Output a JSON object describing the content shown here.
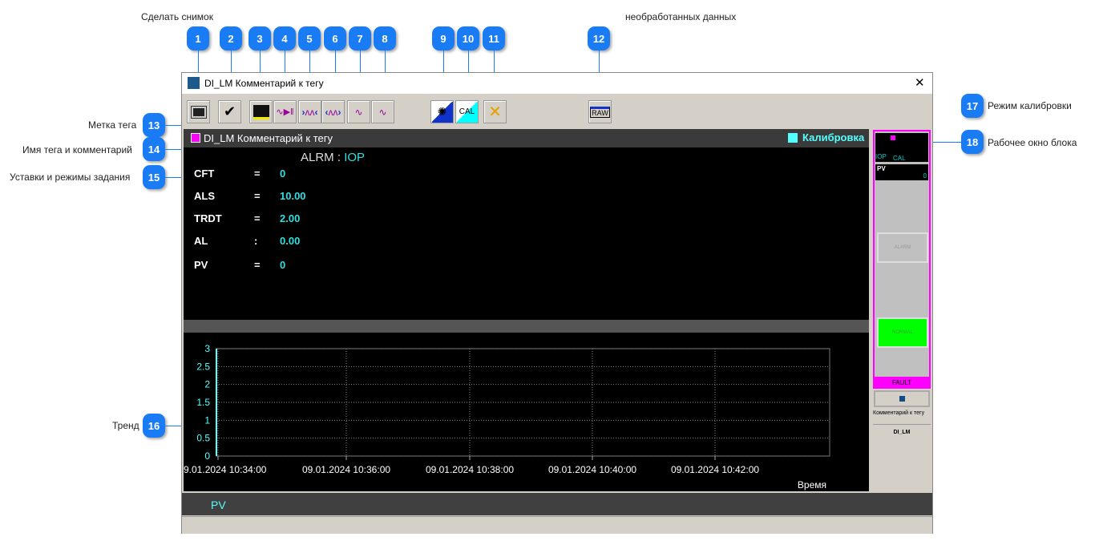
{
  "callouts": {
    "top_labels": [
      "Сделать снимок",
      "необработанных данных"
    ],
    "numbers": [
      "1",
      "2",
      "3",
      "4",
      "5",
      "6",
      "7",
      "8",
      "9",
      "10",
      "11",
      "12",
      "13",
      "14",
      "15",
      "16",
      "17",
      "18"
    ],
    "side_labels": {
      "13": "Метка тега",
      "14": "Имя тега и комментарий",
      "15": "Уставки и режимы задания",
      "16": "Тренд",
      "17": "Режим калибровки",
      "18": "Рабочее окно блока"
    }
  },
  "window": {
    "title": "DI_LM Комментарий к тегу",
    "close": "✕"
  },
  "toolbar": {
    "buttons": [
      "screenshot",
      "acknowledge",
      "trend-settings",
      "trend-pause",
      "zoom-in-x",
      "zoom-out-x",
      "zoom-in-y",
      "zoom-out-y",
      "alarm-suppress",
      "calibration",
      "maintenance",
      "raw-data"
    ],
    "cal_label": "CAL",
    "raw_label": "RAW"
  },
  "header": {
    "tag_label": "DI_LM Комментарий к тегу",
    "mode_label": "Калибровка",
    "tag_color": "#ff00ff",
    "mode_color": "#5ff"
  },
  "status": {
    "alarm_key": "ALRM",
    "sep": ":",
    "alarm_value": "IOP"
  },
  "params": [
    {
      "name": "CFT",
      "sep": "=",
      "value": "0"
    },
    {
      "name": "ALS",
      "sep": "=",
      "value": "10.00"
    },
    {
      "name": "TRDT",
      "sep": "=",
      "value": "2.00"
    },
    {
      "name": "AL",
      "sep": ":",
      "value": "0.00"
    },
    {
      "name": "PV",
      "sep": "=",
      "value": "0"
    }
  ],
  "chart_data": {
    "type": "line",
    "xlabel": "Время",
    "x_ticks": [
      "9.01.2024 10:34:00",
      "09.01.2024 10:36:00",
      "09.01.2024 10:38:00",
      "09.01.2024 10:40:00",
      "09.01.2024 10:42:00"
    ],
    "y_ticks": [
      "0",
      "0.5",
      "1",
      "1.5",
      "2",
      "2.5",
      "3"
    ],
    "ylim": [
      0,
      3
    ],
    "grid": true,
    "series": []
  },
  "legend": {
    "pv": "PV"
  },
  "faceplate": {
    "iop": "IOP",
    "cal": "CAL",
    "pv_label": "PV",
    "pv_value": "0",
    "alarm": "ALARM",
    "normal": "NORMAL",
    "fault": "FAULT",
    "comment": "Комментарий к тегу",
    "tag": "DI_LM"
  }
}
